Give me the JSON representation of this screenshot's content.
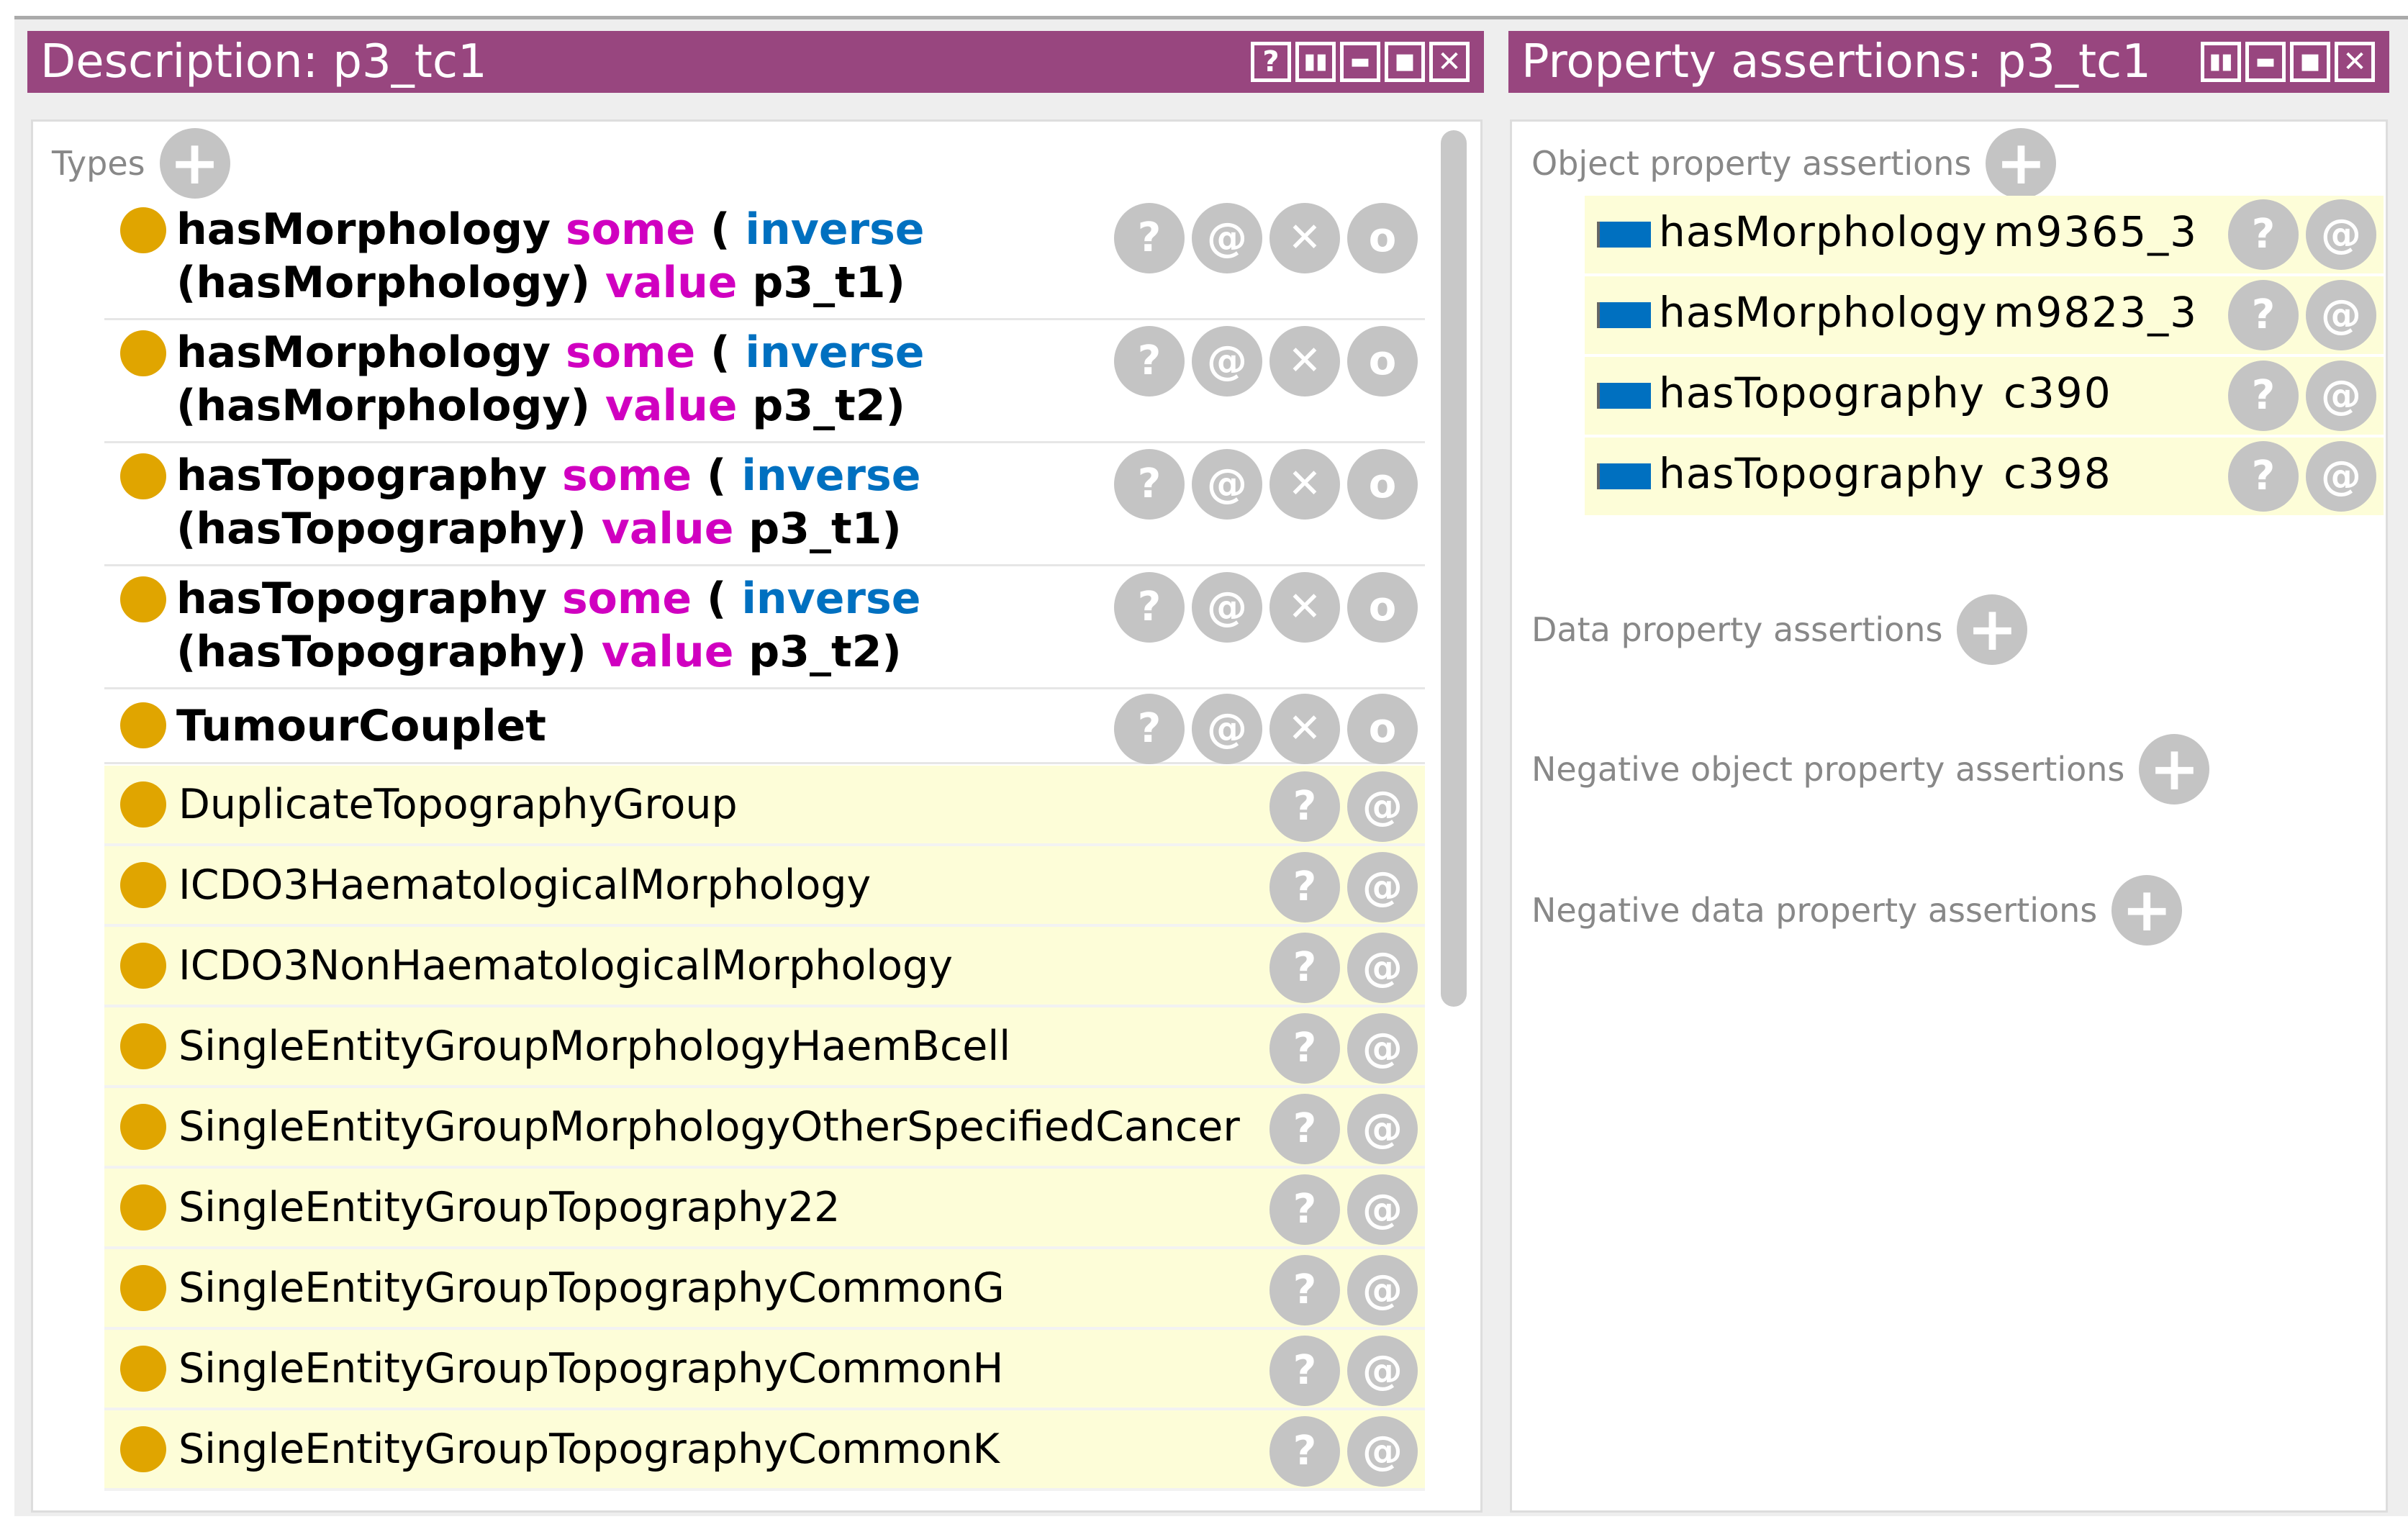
{
  "description_panel": {
    "title": "Description: p3_tc1",
    "title_buttons": [
      "?",
      "▯▯",
      "▭",
      "□",
      "✕"
    ],
    "types_label": "Types",
    "asserted_types": [
      {
        "parts": [
          {
            "t": "hasMorphology",
            "c": ""
          },
          {
            "t": " some",
            "c": "kw-m"
          },
          {
            "t": " ( ",
            "c": ""
          },
          {
            "t": "inverse",
            "c": "kw-b"
          }
        ],
        "line2": [
          {
            "t": "(hasMorphology)",
            "c": ""
          },
          {
            "t": " value",
            "c": "kw-m"
          },
          {
            "t": " p3_t1)",
            "c": ""
          }
        ]
      },
      {
        "parts": [
          {
            "t": "hasMorphology",
            "c": ""
          },
          {
            "t": " some",
            "c": "kw-m"
          },
          {
            "t": " ( ",
            "c": ""
          },
          {
            "t": "inverse",
            "c": "kw-b"
          }
        ],
        "line2": [
          {
            "t": "(hasMorphology)",
            "c": ""
          },
          {
            "t": " value",
            "c": "kw-m"
          },
          {
            "t": " p3_t2)",
            "c": ""
          }
        ]
      },
      {
        "parts": [
          {
            "t": "hasTopography",
            "c": ""
          },
          {
            "t": " some",
            "c": "kw-m"
          },
          {
            "t": " ( ",
            "c": ""
          },
          {
            "t": "inverse",
            "c": "kw-b"
          }
        ],
        "line2": [
          {
            "t": "(hasTopography)",
            "c": ""
          },
          {
            "t": " value",
            "c": "kw-m"
          },
          {
            "t": " p3_t1)",
            "c": ""
          }
        ]
      },
      {
        "parts": [
          {
            "t": "hasTopography",
            "c": ""
          },
          {
            "t": " some",
            "c": "kw-m"
          },
          {
            "t": " ( ",
            "c": ""
          },
          {
            "t": "inverse",
            "c": "kw-b"
          }
        ],
        "line2": [
          {
            "t": "(hasTopography)",
            "c": ""
          },
          {
            "t": " value",
            "c": "kw-m"
          },
          {
            "t": " p3_t2)",
            "c": ""
          }
        ]
      },
      {
        "parts": [
          {
            "t": "TumourCouplet",
            "c": ""
          }
        ],
        "line2": []
      }
    ],
    "inferred_types": [
      "DuplicateTopographyGroup",
      "ICDO3HaematologicalMorphology",
      "ICDO3NonHaematologicalMorphology",
      "SingleEntityGroupMorphologyHaemBcell",
      "SingleEntityGroupMorphologyOtherSpecifiedCancer",
      "SingleEntityGroupTopography22",
      "SingleEntityGroupTopographyCommonG",
      "SingleEntityGroupTopographyCommonH",
      "SingleEntityGroupTopographyCommonK"
    ],
    "asserted_buttons": [
      "?",
      "@",
      "✕",
      "o"
    ],
    "inferred_buttons": [
      "?",
      "@"
    ]
  },
  "property_panel": {
    "title": "Property assertions: p3_tc1",
    "title_buttons": [
      "▯▯",
      "▭",
      "□",
      "✕"
    ],
    "object_label": "Object property assertions",
    "object_assertions": [
      {
        "property": "hasMorphology",
        "value": "m9365_3"
      },
      {
        "property": "hasMorphology",
        "value": "m9823_3"
      },
      {
        "property": "hasTopography",
        "value": "c390"
      },
      {
        "property": "hasTopography",
        "value": "c398"
      }
    ],
    "data_label": "Data property assertions",
    "neg_object_label": "Negative object property assertions",
    "neg_data_label": "Negative data property assertions",
    "row_buttons": [
      "?",
      "@"
    ],
    "plus": "+"
  },
  "colors": {
    "title_bar": "#98467f",
    "class_dot": "#e0a500",
    "property_rect": "#0070c0",
    "inferred_bg": "#fdfdd8"
  }
}
